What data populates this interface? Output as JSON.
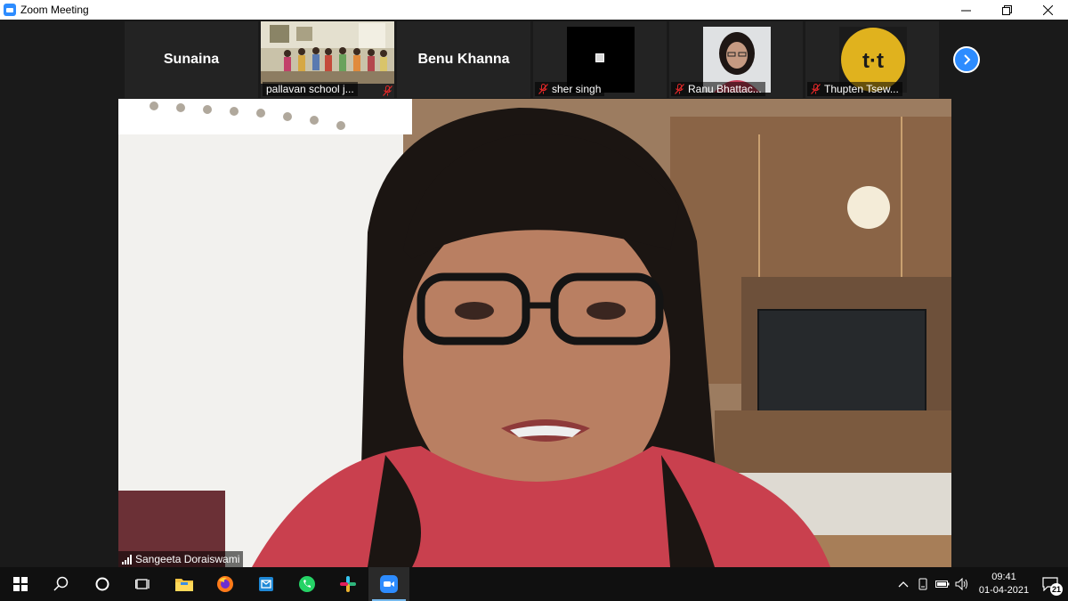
{
  "window": {
    "title": "Zoom Meeting"
  },
  "thumbnails": [
    {
      "id": "sunaina",
      "display_name": "Sunaina",
      "has_video": false,
      "muted": false
    },
    {
      "id": "pallavan",
      "label": "pallavan school j...",
      "has_video": true,
      "muted": true
    },
    {
      "id": "benu",
      "display_name": "Benu Khanna",
      "has_video": false,
      "muted": false
    },
    {
      "id": "sher",
      "label": "sher singh",
      "has_video": true,
      "muted": true
    },
    {
      "id": "ranu",
      "label": "Ranu Bhattac...",
      "has_video": true,
      "muted": true
    },
    {
      "id": "thupten",
      "label": "Thupten Tsew...",
      "has_video": true,
      "muted": true,
      "avatar_text": "t·t"
    }
  ],
  "active_speaker": {
    "name": "Sangeeta Doraiswami"
  },
  "taskbar": {
    "pinned": [
      "windows-start",
      "search",
      "cortana",
      "task-view",
      "file-explorer",
      "firefox",
      "outlook",
      "whatsapp",
      "slack",
      "zoom"
    ],
    "active": "zoom",
    "clock_time": "09:41",
    "clock_date": "01-04-2021",
    "notification_count": "21"
  },
  "colors": {
    "zoom_blue": "#2d8cff",
    "muted_red": "#e02828",
    "meeting_bg": "#1a1a1a",
    "taskbar_bg": "#101010"
  }
}
